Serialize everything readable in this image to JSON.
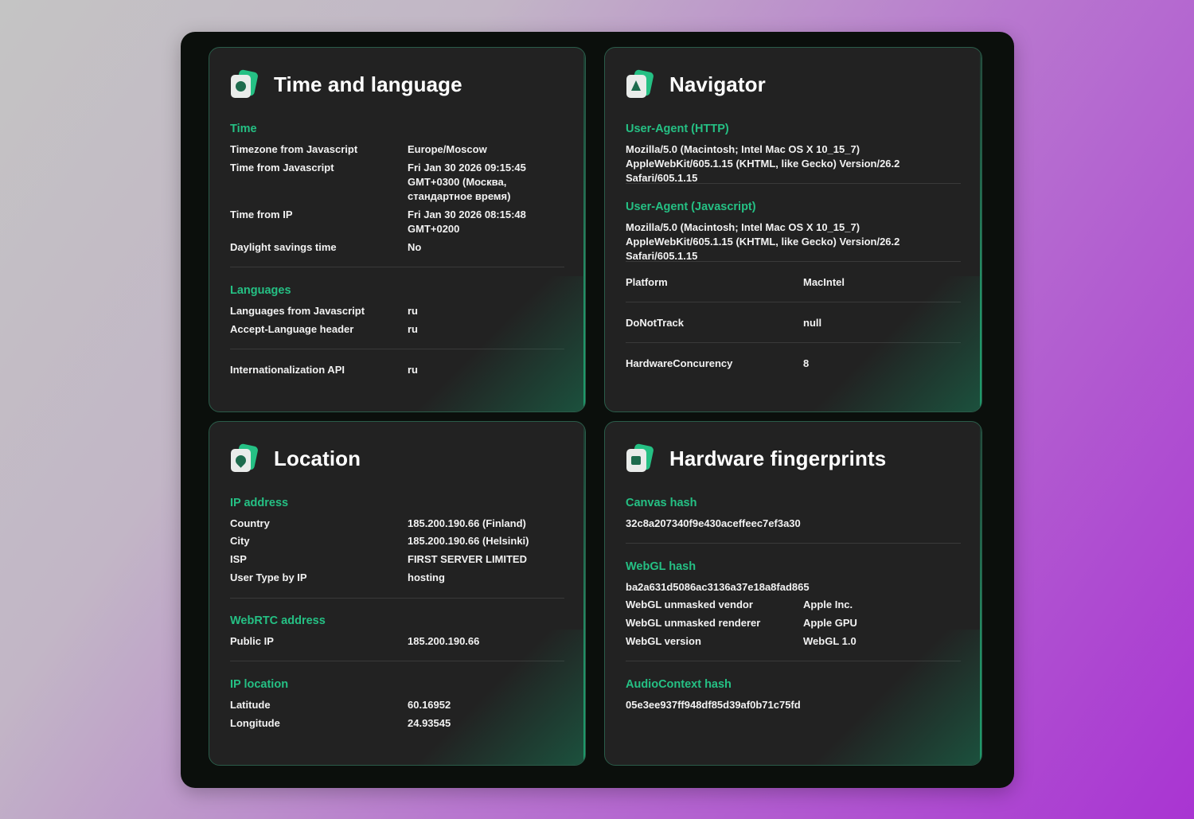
{
  "time_language": {
    "title": "Time and language",
    "icon": "clock-icon",
    "time": {
      "heading": "Time",
      "rows": [
        {
          "k": "Timezone from Javascript",
          "v": "Europe/Moscow"
        },
        {
          "k": "Time from Javascript",
          "v": "Fri Jan 30 2026 09:15:45 GMT+0300 (Москва, стандартное время)"
        },
        {
          "k": "Time from IP",
          "v": "Fri Jan 30 2026 08:15:48 GMT+0200"
        },
        {
          "k": "Daylight savings time",
          "v": "No"
        }
      ]
    },
    "languages": {
      "heading": "Languages",
      "rows": [
        {
          "k": "Languages from Javascript",
          "v": "ru"
        },
        {
          "k": "Accept-Language header",
          "v": "ru"
        }
      ]
    },
    "intl": {
      "k": "Internationalization API",
      "v": "ru"
    }
  },
  "navigator": {
    "title": "Navigator",
    "icon": "navigator-icon",
    "ua_http": {
      "heading": "User-Agent (HTTP)",
      "value": "Mozilla/5.0 (Macintosh; Intel Mac OS X 10_15_7) AppleWebKit/605.1.15 (KHTML, like Gecko) Version/26.2 Safari/605.1.15"
    },
    "ua_js": {
      "heading": "User-Agent (Javascript)",
      "value": "Mozilla/5.0 (Macintosh; Intel Mac OS X 10_15_7) AppleWebKit/605.1.15 (KHTML, like Gecko) Version/26.2 Safari/605.1.15"
    },
    "platform": {
      "k": "Platform",
      "v": "MacIntel"
    },
    "dnt": {
      "k": "DoNotTrack",
      "v": "null"
    },
    "hw": {
      "k": "HardwareConcurency",
      "v": "8"
    }
  },
  "location": {
    "title": "Location",
    "icon": "location-pin-icon",
    "ip": {
      "heading": "IP address",
      "rows": [
        {
          "k": "Country",
          "v": "185.200.190.66 (Finland)"
        },
        {
          "k": "City",
          "v": "185.200.190.66 (Helsinki)"
        },
        {
          "k": "ISP",
          "v": "FIRST SERVER LIMITED"
        },
        {
          "k": "User Type by IP",
          "v": "hosting"
        }
      ]
    },
    "webrtc": {
      "heading": "WebRTC address",
      "rows": [
        {
          "k": "Public IP",
          "v": "185.200.190.66"
        }
      ]
    },
    "iploc": {
      "heading": "IP location",
      "rows": [
        {
          "k": "Latitude",
          "v": "60.16952"
        },
        {
          "k": "Longitude",
          "v": "24.93545"
        }
      ]
    }
  },
  "hardware": {
    "title": "Hardware fingerprints",
    "icon": "chip-icon",
    "canvas": {
      "heading": "Canvas hash",
      "value": "32c8a207340f9e430aceffeec7ef3a30"
    },
    "webgl": {
      "heading": "WebGL hash",
      "value": "ba2a631d5086ac3136a37e18a8fad865",
      "rows": [
        {
          "k": "WebGL unmasked vendor",
          "v": "Apple Inc."
        },
        {
          "k": "WebGL unmasked renderer",
          "v": "Apple GPU"
        },
        {
          "k": "WebGL version",
          "v": "WebGL 1.0"
        }
      ]
    },
    "audio": {
      "heading": "AudioContext hash",
      "value": "05e3ee937ff948df85d39af0b71c75fd"
    }
  },
  "colors": {
    "accent": "#25c084",
    "card": "#222222",
    "frame": "#0b0f0c"
  }
}
